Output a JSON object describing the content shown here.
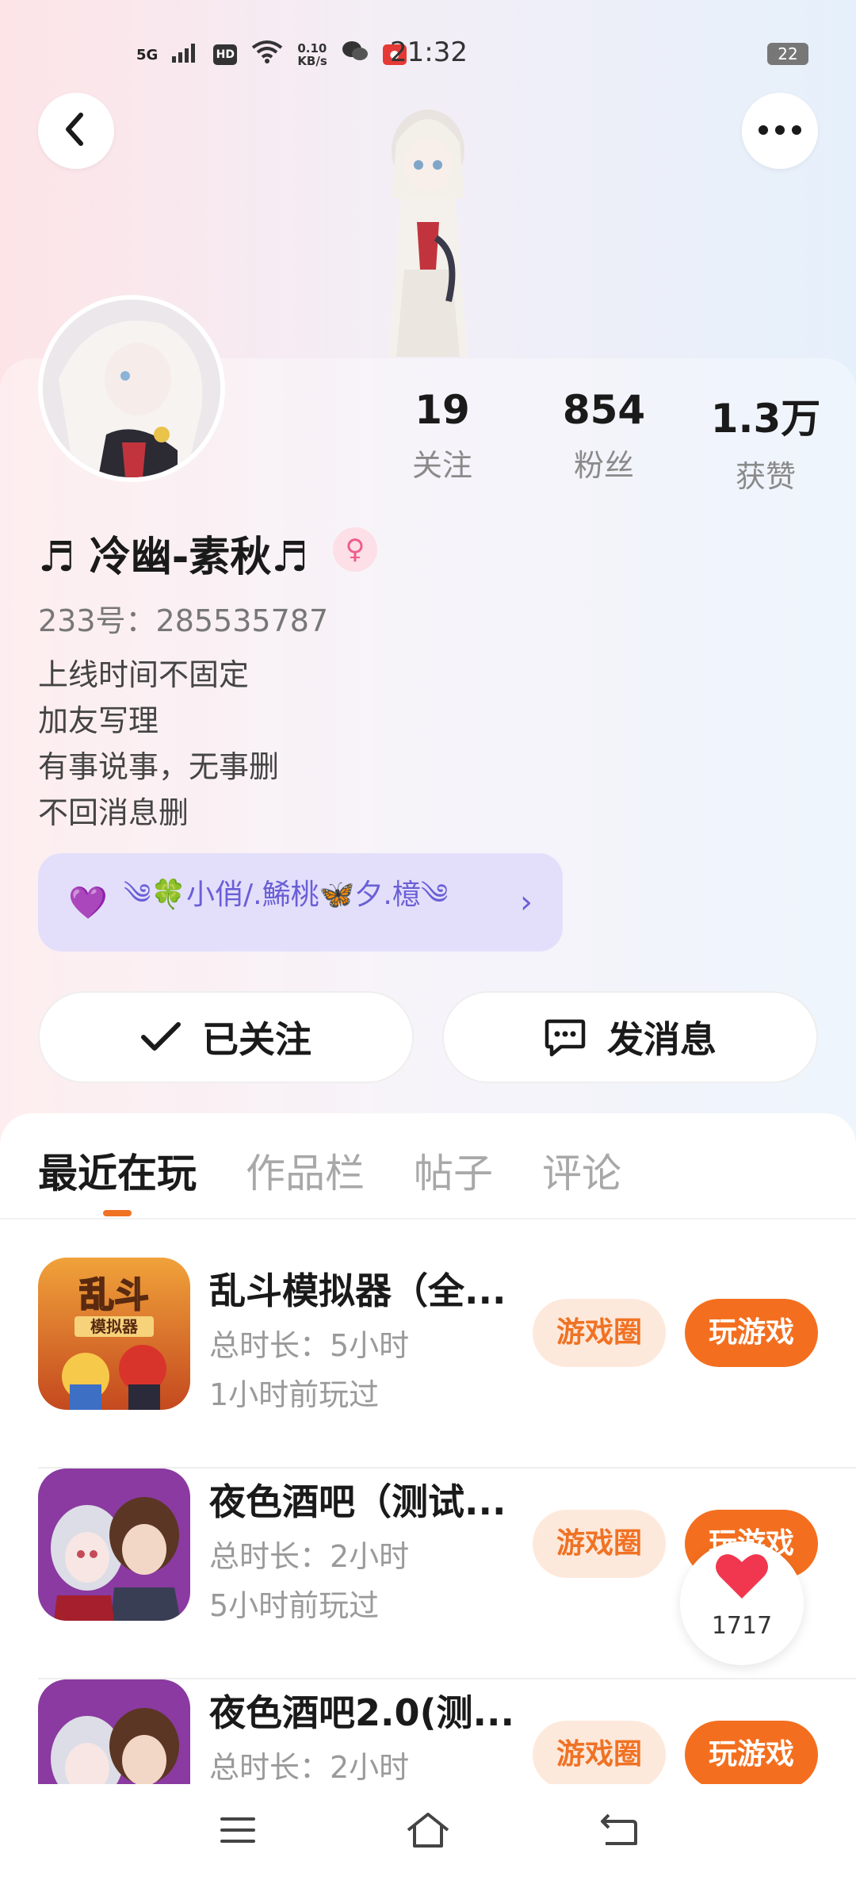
{
  "status_bar": {
    "network": "5G",
    "hd": "HD",
    "speed_value": "0.10",
    "speed_unit": "KB/s",
    "time": "21:32",
    "battery": "22"
  },
  "profile": {
    "stats": [
      {
        "value": "19",
        "label": "关注"
      },
      {
        "value": "854",
        "label": "粉丝"
      },
      {
        "value": "1.3万",
        "label": "获赞"
      }
    ],
    "nickname": "♬ 冷幽-素秋♬",
    "gender_symbol": "♀",
    "uid": "233号：285535787",
    "bio": [
      "上线时间不固定",
      "加友写理",
      "有事说事，无事删",
      "不回消息删"
    ],
    "guild": {
      "heart": "💜",
      "name": "༄🍀小俏/.鯑桃🦋夕.檍༄",
      "chevron": "›"
    }
  },
  "actions": {
    "follow_label": "已关注",
    "message_label": "发消息"
  },
  "tabs": [
    "最近在玩",
    "作品栏",
    "帖子",
    "评论"
  ],
  "games": [
    {
      "title": "乱斗模拟器（全...",
      "duration": "总时长：5小时",
      "last_played": "1小时前玩过",
      "icon_text_1": "乱斗",
      "icon_text_2": "模拟器"
    },
    {
      "title": "夜色酒吧（测试...",
      "duration": "总时长：2小时",
      "last_played": "5小时前玩过"
    },
    {
      "title": "夜色酒吧2.0(测...",
      "duration": "总时长：2小时",
      "last_played": ""
    }
  ],
  "game_buttons": {
    "circle_label": "游戏圈",
    "play_label": "玩游戏"
  },
  "like_float": {
    "count": "1717"
  },
  "colors": {
    "accent_orange": "#f36f1f",
    "pill_bg": "#fde9dc",
    "guild_bg": "#e3dffb",
    "like_red": "#f0374f"
  },
  "icons": {
    "back": "chevron-left-icon",
    "more": "more-dots-icon",
    "follow_check": "check-icon",
    "message": "chat-bubble-icon",
    "nav": [
      "menu-icon",
      "home-icon",
      "back-icon"
    ]
  }
}
